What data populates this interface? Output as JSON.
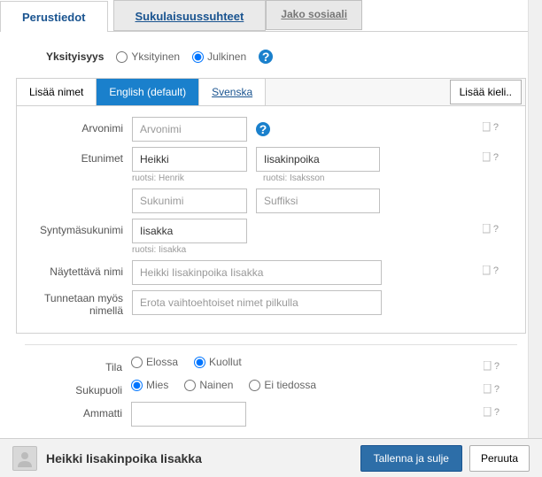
{
  "tabs": {
    "basics": "Perustiedot",
    "relations": "Sukulaisuussuhteet",
    "share": "Jako sosiaali"
  },
  "privacy": {
    "label": "Yksityisyys",
    "private": "Yksityinen",
    "public": "Julkinen"
  },
  "name_tabs": {
    "add_names": "Lisää nimet",
    "english": "English (default)",
    "svenska": "Svenska",
    "add_lang": "Lisää kieli.."
  },
  "fields": {
    "title_label": "Arvonimi",
    "title_ph": "Arvonimi",
    "first_label": "Etunimet",
    "first_val": "Heikki",
    "middle_val": "Iisakinpoika",
    "first_hint": "ruotsi: Henrik",
    "middle_hint": "ruotsi: Isaksson",
    "last_ph": "Sukunimi",
    "suffix_ph": "Suffiksi",
    "birth_last_label": "Syntymäsukunimi",
    "birth_last_val": "Iisakka",
    "birth_last_hint": "ruotsi: Iisakka",
    "display_label": "Näytettävä nimi",
    "display_ph": "Heikki Iisakinpoika Iisakka",
    "aka_label": "Tunnetaan myös nimellä",
    "aka_ph": "Erota vaihtoehtoiset nimet pilkulla"
  },
  "status": {
    "tila_label": "Tila",
    "alive": "Elossa",
    "dead": "Kuollut",
    "gender_label": "Sukupuoli",
    "male": "Mies",
    "female": "Nainen",
    "unknown": "Ei tiedossa",
    "occupation_label": "Ammatti"
  },
  "footer": {
    "name": "Heikki Iisakinpoika Iisakka",
    "save": "Tallenna ja sulje",
    "cancel": "Peruuta"
  },
  "help_q": "?"
}
